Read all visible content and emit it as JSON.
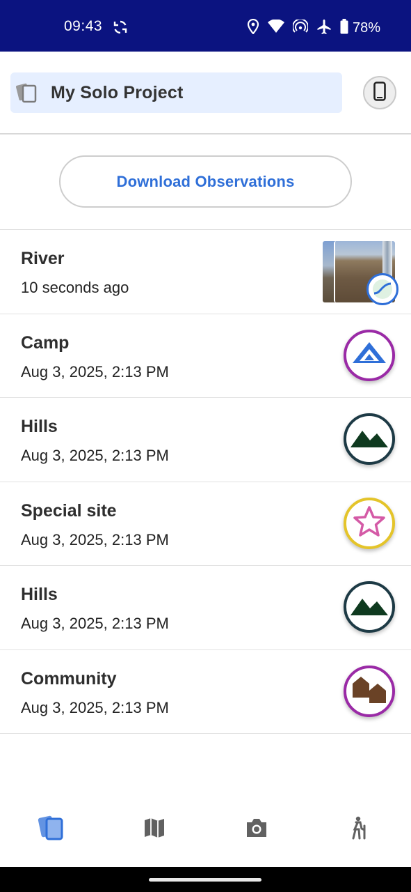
{
  "status_bar": {
    "time": "09:43",
    "battery": "78%",
    "icons": [
      "sync-icon",
      "location-icon",
      "wifi-icon",
      "hotspot-icon",
      "airplane-icon",
      "battery-icon"
    ]
  },
  "header": {
    "project_name": "My Solo Project",
    "project_icon": "cards-icon",
    "device_icon": "phone-icon"
  },
  "download_button_label": "Download Observations",
  "observations": [
    {
      "title": "River",
      "time": "10 seconds ago",
      "thumb": "photo",
      "badge_icon": "map-overlay-icon",
      "border": "#2f6fd8"
    },
    {
      "title": "Camp",
      "time": "Aug 3, 2025, 2:13 PM",
      "thumb": "camp-icon",
      "border": "#9a2aa6",
      "color": "#2f6fd8"
    },
    {
      "title": "Hills",
      "time": "Aug 3, 2025, 2:13 PM",
      "thumb": "hills-icon",
      "border": "#1d3a45",
      "color": "#0f3a1f"
    },
    {
      "title": "Special site",
      "time": "Aug 3, 2025, 2:13 PM",
      "thumb": "star-icon",
      "border": "#e4c42a",
      "color": "#d45aa6"
    },
    {
      "title": "Hills",
      "time": "Aug 3, 2025, 2:13 PM",
      "thumb": "hills-icon",
      "border": "#1d3a45",
      "color": "#0f3a1f"
    },
    {
      "title": "Community",
      "time": "Aug 3, 2025, 2:13 PM",
      "thumb": "houses-icon",
      "border": "#9a2aa6",
      "color": "#6a4226"
    }
  ],
  "bottom_nav": [
    {
      "id": "observations",
      "icon": "cards-icon",
      "active": true
    },
    {
      "id": "map",
      "icon": "map-icon",
      "active": false
    },
    {
      "id": "camera",
      "icon": "camera-icon",
      "active": false
    },
    {
      "id": "tracks",
      "icon": "hiker-icon",
      "active": false
    }
  ],
  "colors": {
    "status_bar": "#0b1380",
    "accent": "#2f6fd8",
    "pill": "#e6efff"
  }
}
